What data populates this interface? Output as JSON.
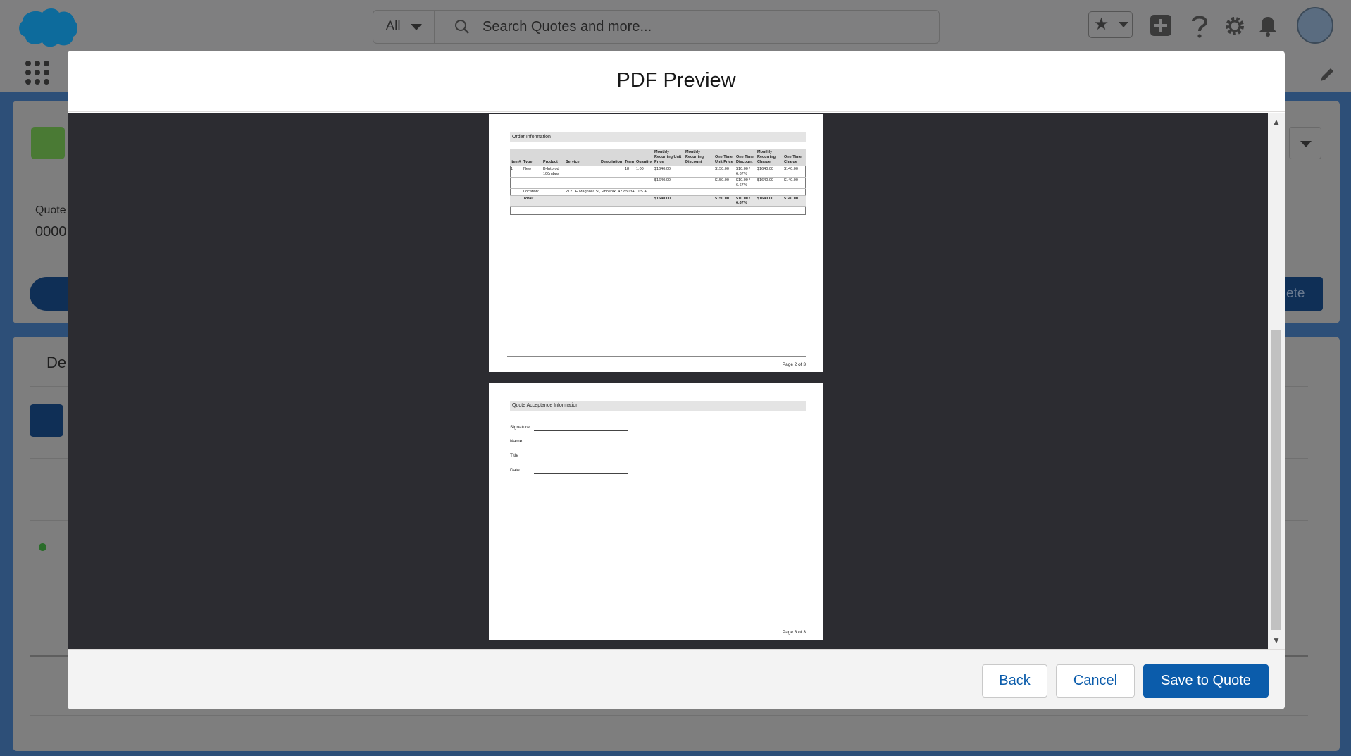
{
  "global_header": {
    "search_scope": "All",
    "search_placeholder": "Search Quotes and more..."
  },
  "background_record": {
    "field_label_fragment": "Quote",
    "field_value_fragment": "0000",
    "section_title_fragment": "De",
    "button_fragment": "ete"
  },
  "modal": {
    "title": "PDF Preview",
    "pdf": {
      "page2": {
        "section_title": "Order Information",
        "table": {
          "headers": [
            "Item#",
            "Type",
            "Product",
            "Service",
            "Description",
            "Term",
            "Quantity",
            "Monthly Recurring Unit Price",
            "Monthly Recurring Discount",
            "One Time Unit Price",
            "One Time Discount",
            "Monthly Recurring Charge",
            "One Time Charge"
          ],
          "rows": [
            [
              "1",
              "New",
              "B-Intprod 100mbps",
              "",
              "",
              "18",
              "1.00",
              "$1640.00",
              "",
              "$150.00",
              "$10.00 / 6.67%",
              "$1640.00",
              "$140.00"
            ],
            [
              "",
              "",
              "",
              "",
              "",
              "",
              "",
              "$1640.00",
              "",
              "$150.00",
              "$10.00 / 6.67%",
              "$1640.00",
              "$140.00"
            ]
          ],
          "location_label": "Location:",
          "location_value": "2121 E Magnolia St, Phoenix, AZ 85034, U.S.A.",
          "total_label": "Total:",
          "totals": [
            "$1640.00",
            "",
            "$150.00",
            "$10.00 / 6.67%",
            "$1640.00",
            "$140.00"
          ]
        },
        "page_label": "Page 2 of 3"
      },
      "page3": {
        "section_title": "Quote Acceptance Information",
        "fields": [
          "Signature",
          "Name",
          "Title",
          "Date"
        ],
        "page_label": "Page 3 of 3"
      }
    },
    "buttons": {
      "back": "Back",
      "cancel": "Cancel",
      "save": "Save to Quote"
    }
  },
  "colors": {
    "brand": "#0b5cab",
    "viewer_background": "#2c2c31",
    "overlay_dim": "#7f7f80"
  }
}
